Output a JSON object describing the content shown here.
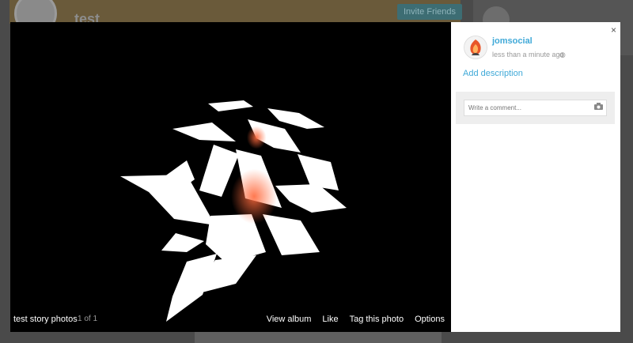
{
  "background": {
    "profile_name": "test",
    "invite_button": "Invite Friends"
  },
  "viewer": {
    "album_title": "test story photos",
    "counter": "1 of 1",
    "actions": [
      "View album",
      "Like",
      "Tag this photo",
      "Options"
    ]
  },
  "panel": {
    "close_label": "×",
    "author": "jomsocial",
    "time": "less than a minute ago",
    "add_description": "Add description",
    "comment_placeholder": "Write a comment..."
  },
  "colors": {
    "link": "#3fa9d8",
    "photo_bg": "#000000",
    "accent": "#ff6a3d"
  },
  "icons": [
    "close-icon",
    "globe-icon",
    "camera-icon"
  ]
}
